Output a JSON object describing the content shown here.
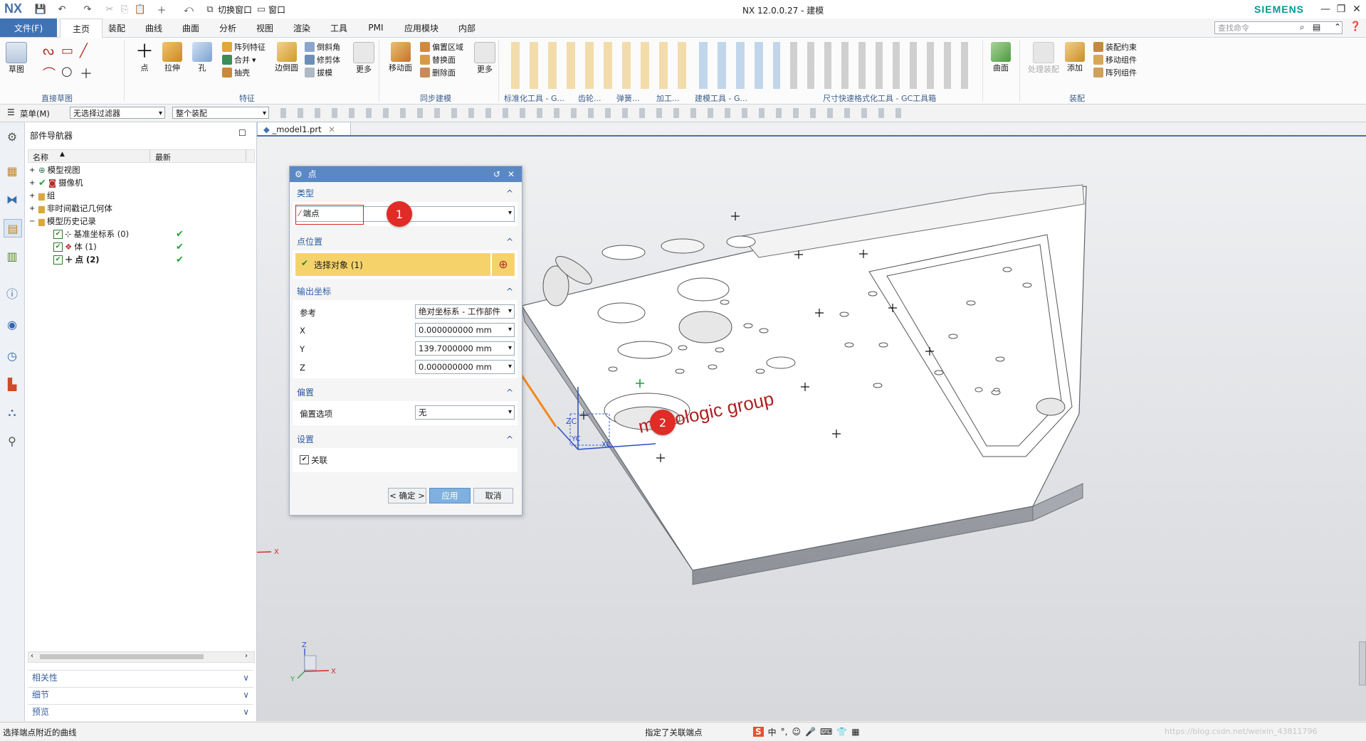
{
  "app": {
    "logo": "NX",
    "title": "NX 12.0.0.27 - 建模",
    "brand": "SIEMENS",
    "quick_access": {
      "switch_window": "切换窗口",
      "window": "窗口"
    }
  },
  "menu_tabs": [
    "文件(F)",
    "主页",
    "装配",
    "曲线",
    "曲面",
    "分析",
    "视图",
    "渲染",
    "工具",
    "PMI",
    "应用模块",
    "内部"
  ],
  "search_placeholder": "查找命令",
  "ribbon": {
    "sketch": "草图",
    "sketch_group": "直接草图",
    "point": "点",
    "extrude": "拉伸",
    "hole": "孔",
    "array_feature": "阵列特征",
    "unite": "合并",
    "shell": "抽壳",
    "edge_blend": "边倒圆",
    "chamfer": "倒斜角",
    "trim_body": "修剪体",
    "draft": "拔模",
    "more1": "更多",
    "feature_group": "特征",
    "move_face": "移动面",
    "offset_region": "偏置区域",
    "replace_face": "替换面",
    "delete_face": "删除面",
    "more2": "更多",
    "sync_group": "同步建模",
    "std_tools": "标准化工具 - G...",
    "gear": "齿轮...",
    "spring": "弹簧...",
    "machining": "加工...",
    "modeling_tools": "建模工具 - G...",
    "dim_tools": "尺寸快速格式化工具 - GC工具箱",
    "surface": "曲面",
    "process_assembly": "处理装配",
    "add": "添加",
    "assembly_constraint": "装配约束",
    "move_component": "移动组件",
    "array_component": "阵列组件",
    "assembly_group": "装配"
  },
  "selbar": {
    "menu": "菜单(M)",
    "filter": "无选择过滤器",
    "scope": "整个装配"
  },
  "navigator": {
    "title": "部件导航器",
    "col_name": "名称",
    "col_latest": "最新",
    "nodes": [
      {
        "label": "模型视图",
        "depth": 0
      },
      {
        "label": "摄像机",
        "depth": 0
      },
      {
        "label": "组",
        "depth": 0
      },
      {
        "label": "非时间戳记几何体",
        "depth": 0
      },
      {
        "label": "模型历史记录",
        "depth": 0
      },
      {
        "label": "基准坐标系 (0)",
        "depth": 1,
        "latest": "✔"
      },
      {
        "label": "体 (1)",
        "depth": 1,
        "latest": "✔"
      },
      {
        "label": "点 (2)",
        "depth": 1,
        "latest": "✔"
      }
    ],
    "panels": [
      "相关性",
      "细节",
      "预览"
    ]
  },
  "doc_tab": "_model1.prt",
  "dialog": {
    "title": "点",
    "sec_type": "类型",
    "type_value": "端点",
    "sec_location": "点位置",
    "select_object": "选择对象 (1)",
    "sec_output": "输出坐标",
    "ref_label": "参考",
    "ref_value": "绝对坐标系 - 工作部件",
    "x_label": "X",
    "x_value": "0.000000000",
    "y_label": "Y",
    "y_value": "139.7000000",
    "z_label": "Z",
    "z_value": "0.000000000",
    "unit": "mm",
    "sec_offset": "偏置",
    "offset_label": "偏置选项",
    "offset_value": "无",
    "sec_settings": "设置",
    "associative": "关联",
    "ok": "< 确定 >",
    "apply": "应用",
    "cancel": "取消"
  },
  "callouts": [
    "1",
    "2"
  ],
  "model": {
    "logo_text": "metrologic group"
  },
  "triad": {
    "zc": "ZC",
    "yc": "YC",
    "xc": "XC",
    "z": "Z",
    "y": "Y",
    "x": "X"
  },
  "status": {
    "left": "选择端点附近的曲线",
    "center": "指定了关联端点",
    "watermark": "https://blog.csdn.net/weixin_43811796"
  },
  "colors": {
    "accent": "#3f73b4",
    "highlight": "#f6d36a",
    "callout": "#e02b26"
  }
}
